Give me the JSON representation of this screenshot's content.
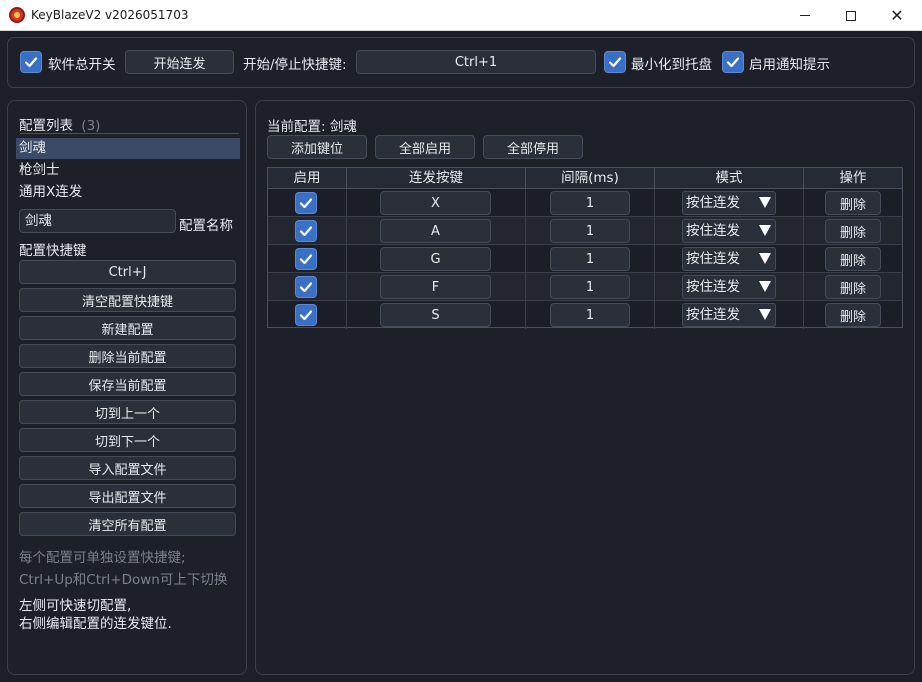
{
  "window": {
    "title": "KeyBlazeV2 v2026051703"
  },
  "topbar": {
    "master_switch_label": "软件总开关",
    "master_switch_checked": true,
    "start_button": "开始连发",
    "hotkey_label": "开始/停止快捷键:",
    "hotkey_value": "Ctrl+1",
    "minimize_tray_label": "最小化到托盘",
    "minimize_tray_checked": true,
    "notify_label": "启用通知提示",
    "notify_checked": true
  },
  "left": {
    "list_title": "配置列表",
    "list_count": "(3)",
    "configs": [
      "剑魂",
      "枪剑士",
      "通用X连发"
    ],
    "selected_index": 0,
    "name_value": "剑魂",
    "name_label": "配置名称",
    "hotkey_label": "配置快捷键",
    "buttons": [
      "Ctrl+J",
      "清空配置快捷键",
      "新建配置",
      "删除当前配置",
      "保存当前配置",
      "切到上一个",
      "切到下一个",
      "导入配置文件",
      "导出配置文件",
      "清空所有配置"
    ],
    "hint1": "每个配置可单独设置快捷键;",
    "hint2": "Ctrl+Up和Ctrl+Down可上下切换",
    "note1": "左侧可快速切配置,",
    "note2": "右侧编辑配置的连发键位."
  },
  "right": {
    "current_label": "当前配置: 剑魂",
    "buttons": {
      "add": "添加键位",
      "enable_all": "全部启用",
      "disable_all": "全部停用"
    },
    "columns": [
      "启用",
      "连发按键",
      "间隔(ms)",
      "模式",
      "操作"
    ],
    "rows": [
      {
        "enabled": true,
        "key": "X",
        "interval": "1",
        "mode": "按住连发",
        "action": "删除"
      },
      {
        "enabled": true,
        "key": "A",
        "interval": "1",
        "mode": "按住连发",
        "action": "删除"
      },
      {
        "enabled": true,
        "key": "G",
        "interval": "1",
        "mode": "按住连发",
        "action": "删除"
      },
      {
        "enabled": true,
        "key": "F",
        "interval": "1",
        "mode": "按住连发",
        "action": "删除"
      },
      {
        "enabled": true,
        "key": "S",
        "interval": "1",
        "mode": "按住连发",
        "action": "删除"
      }
    ]
  },
  "colors": {
    "accent": "#3a6fc4",
    "background": "#1c1f28",
    "selected": "#3b4a66"
  }
}
